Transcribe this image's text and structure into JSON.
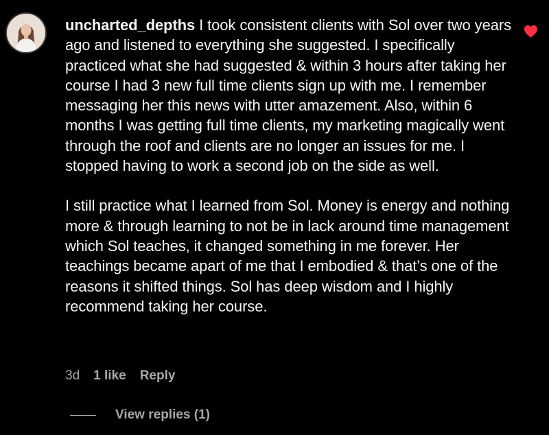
{
  "comment": {
    "username": "uncharted_depths",
    "paragraph_1": "I took consistent clients with Sol over two years ago and listened to everything she suggested. I specifically practiced what she had suggested & within 3 hours after taking her course I had 3 new full time clients sign up with me. I remember messaging her this news with utter amazement. Also, within 6 months I was getting full time clients, my marketing magically went through the roof and clients are no longer an issues for me. I stopped having to work a second job on the side as well.",
    "paragraph_2": "I still practice what I learned from Sol. Money is energy and nothing more & through learning to not be in lack around time management which Sol teaches, it changed something in me forever. Her teachings became apart of me that I embodied & that’s one of the reasons it shifted things. Sol has deep wisdom and I highly recommend taking her course.",
    "time_ago": "3d",
    "likes_label": "1 like",
    "reply_label": "Reply",
    "view_replies_label": "View replies (1)",
    "liked": true
  },
  "icons": {
    "heart": "heart-icon",
    "avatar": "profile-photo"
  },
  "colors": {
    "background": "#000000",
    "text": "#f5f5f5",
    "secondary_text": "#a8a8a8",
    "heart": "#ff3040"
  }
}
